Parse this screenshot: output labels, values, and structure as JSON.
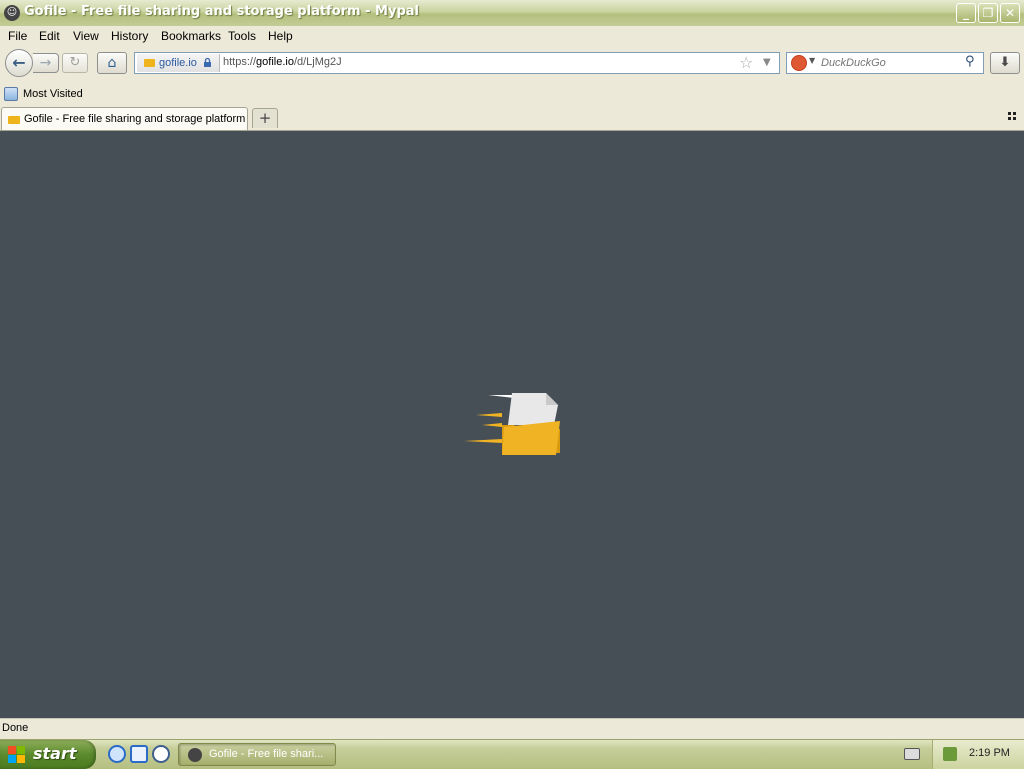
{
  "window": {
    "title": "Gofile - Free file sharing and storage platform - Mypal",
    "controls": [
      "minimize",
      "maximize",
      "close"
    ]
  },
  "menu": {
    "items": [
      "File",
      "Edit",
      "View",
      "History",
      "Bookmarks",
      "Tools",
      "Help"
    ]
  },
  "nav": {
    "identity_host": "gofile.io",
    "url_prefix": "https://",
    "url_host": "gofile.io",
    "url_path": "/d/LjMg2J",
    "search_engine": "duckduckgo-icon",
    "search_placeholder": "DuckDuckGo"
  },
  "bookmarks": {
    "items": [
      {
        "label": "Most Visited",
        "icon": "bookmark-folder-icon"
      }
    ]
  },
  "tabs": [
    {
      "label": "Gofile - Free file sharing and storage platform",
      "active": true
    }
  ],
  "content": {
    "background": "#464e56",
    "loader_colors": {
      "folder": "#f0b323",
      "paper": "#e8e8e8"
    }
  },
  "status": {
    "text": "Done"
  },
  "taskbar": {
    "start_label": "start",
    "quick_launch": [
      "internet-explorer-icon",
      "outlook-express-icon",
      "media-player-icon"
    ],
    "task_label": "Gofile - Free file shari...",
    "clock": "2:19 PM"
  }
}
